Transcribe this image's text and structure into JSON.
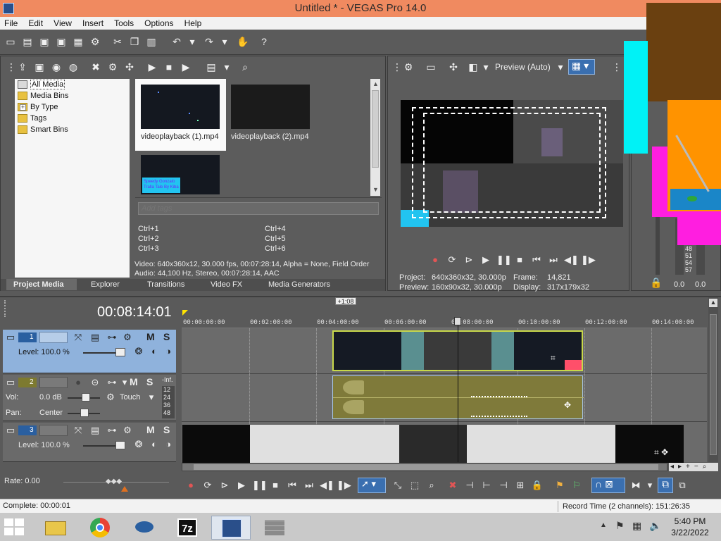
{
  "window": {
    "title": "Untitled * - VEGAS Pro 14.0"
  },
  "menu": [
    "File",
    "Edit",
    "View",
    "Insert",
    "Tools",
    "Options",
    "Help"
  ],
  "media": {
    "tree": [
      "All Media",
      "Media Bins",
      "By Type",
      "Tags",
      "Smart Bins"
    ],
    "expander": "+",
    "files": [
      "videoplayback (1).mp4",
      "videoplayback (2).mp4"
    ],
    "third_thumb_text": "Speedy Gonzalo Tralla Tale By Kiba",
    "tags_placeholder": "Add tags",
    "shortcuts": [
      "Ctrl+1",
      "Ctrl+2",
      "Ctrl+3",
      "Ctrl+4",
      "Ctrl+5",
      "Ctrl+6"
    ],
    "info_video": "Video: 640x360x12, 30.000 fps, 00:07:28:14, Alpha = None, Field Order",
    "info_audio": "Audio: 44,100 Hz, Stereo, 00:07:28:14, AAC",
    "tabs": [
      "Project Media",
      "Explorer",
      "Transitions",
      "Video FX",
      "Media Generators"
    ]
  },
  "preview": {
    "quality": "Preview (Auto)",
    "project_label": "Project:",
    "project_value": "640x360x32, 30.000p",
    "preview_label": "Preview:",
    "preview_value": "160x90x32, 30.000p",
    "frame_label": "Frame:",
    "frame_value": "14,821",
    "display_label": "Display:",
    "display_value": "317x179x32"
  },
  "meters": {
    "ticks": [
      "48",
      "51",
      "54",
      "57"
    ],
    "left": "0.0",
    "right": "0.0"
  },
  "timeline": {
    "timecode": "00:08:14:01",
    "marker": "+1:08",
    "ruler": [
      "00:00:00:00",
      "00:02:00:00",
      "00:04:00:00",
      "00:06:00:00",
      "00:08:00:00",
      "00:10:00:00",
      "00:12:00:00",
      "00:14:00:00"
    ],
    "tracks": [
      {
        "num": "1",
        "level": "Level: 100.0 %"
      },
      {
        "num": "2",
        "vol_label": "Vol:",
        "vol": "0.0 dB",
        "pan_label": "Pan:",
        "pan": "Center",
        "mode": "Touch",
        "inf": "-Inf.",
        "meter": [
          "12",
          "24",
          "36",
          "48"
        ]
      },
      {
        "num": "3",
        "level": "Level: 100.0 %"
      }
    ],
    "m_label": "M",
    "s_label": "S",
    "rate": "Rate: 0.00"
  },
  "status": {
    "complete": "Complete: 00:00:01",
    "record": "Record Time (2 channels): 151:26:35"
  },
  "taskbar": {
    "time": "5:40 PM",
    "date": "3/22/2022",
    "sevenzip": "7z"
  }
}
